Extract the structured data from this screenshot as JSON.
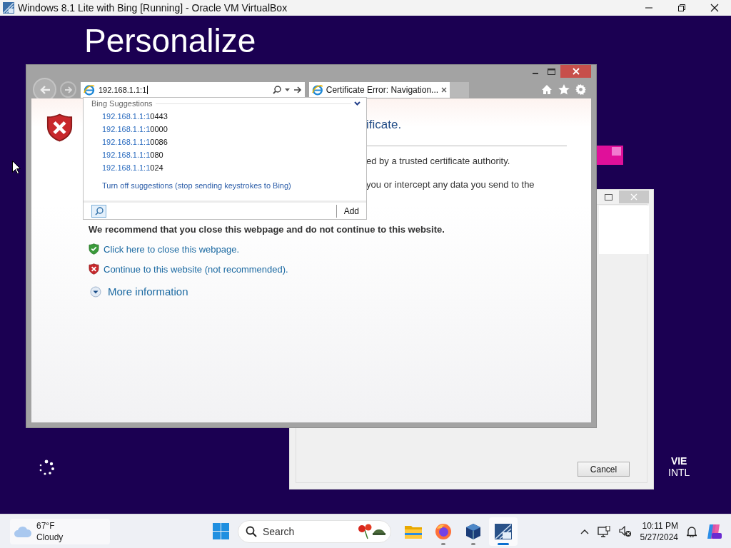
{
  "host_window": {
    "title": "Windows 8.1 Lite with Bing [Running] - Oracle VM VirtualBox"
  },
  "vm_screen": {
    "heading": "Personalize",
    "keyboard": {
      "language": "VIE",
      "layout": "INTL"
    }
  },
  "dialog": {
    "button": "Cancel"
  },
  "browser": {
    "address": "192.168.1.1:1",
    "tabs": [
      {
        "title": "Certificate Error: Navigation...",
        "selected": true
      }
    ],
    "page": {
      "heading": "ificate.",
      "lines": [
        "ed by a trusted certificate authority.",
        "you or intercept any data you send to the"
      ],
      "recommendation": "We recommend that you close this webpage and do not continue to this website.",
      "actions": [
        {
          "kind": "safe",
          "label": "Click here to close this webpage."
        },
        {
          "kind": "unsafe",
          "label": "Continue to this website (not recommended)."
        }
      ],
      "more": "More information"
    },
    "suggestions": {
      "header": "Bing Suggestions",
      "items": [
        {
          "typed": "192.168.1.1:1",
          "rest": "0443"
        },
        {
          "typed": "192.168.1.1:1",
          "rest": "0000"
        },
        {
          "typed": "192.168.1.1:1",
          "rest": "0086"
        },
        {
          "typed": "192.168.1.1:1",
          "rest": "080"
        },
        {
          "typed": "192.168.1.1:1",
          "rest": "024"
        }
      ],
      "turn_off": "Turn off suggestions (stop sending keystrokes to Bing)",
      "add": "Add"
    }
  },
  "taskbar": {
    "weather": {
      "temp": "67°F",
      "condition": "Cloudy"
    },
    "search_label": "Search",
    "apps": [
      {
        "kind": "explorer",
        "running": false,
        "selected": false
      },
      {
        "kind": "firefox",
        "running": true,
        "selected": false
      },
      {
        "kind": "virtualbox",
        "running": true,
        "selected": false
      },
      {
        "kind": "vm",
        "running": true,
        "selected": true
      }
    ],
    "time": "10:11 PM",
    "date": "5/27/2024"
  }
}
